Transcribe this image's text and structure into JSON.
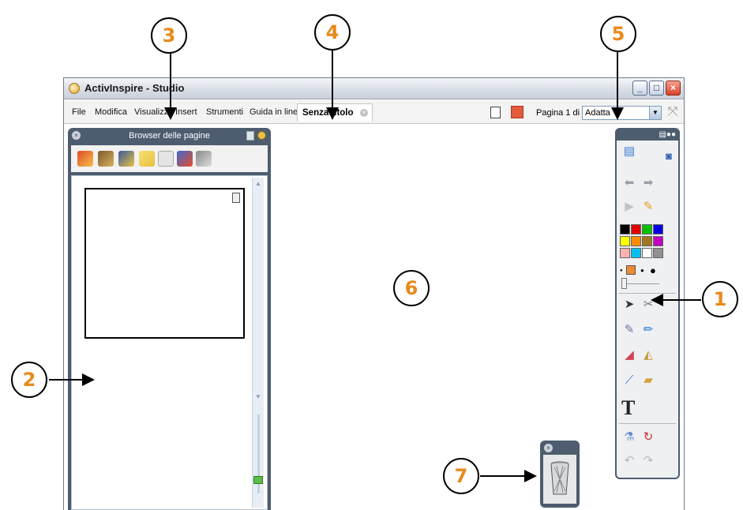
{
  "window": {
    "title": "ActivInspire - Studio"
  },
  "menu": {
    "items": [
      "File",
      "Modifica",
      "Visualizza",
      "Insert",
      "Strumenti",
      "Guida in linea"
    ]
  },
  "document_tab": {
    "label": "Senza titolo",
    "close_glyph": "×"
  },
  "page_nav": {
    "indicator": "Pagina 1 di 1",
    "zoom_value": "Adatta"
  },
  "page_browser": {
    "title": "Browser delle pagine",
    "tools": [
      "page-browser-icon",
      "resource-browser-icon",
      "object-browser-icon",
      "notes-browser-icon",
      "property-browser-icon",
      "action-browser-icon",
      "voting-browser-icon"
    ]
  },
  "toolbox": {
    "colors": [
      "#000000",
      "#e00000",
      "#00c000",
      "#0000e0",
      "#ffff00",
      "#ff8c00",
      "#a07820",
      "#c000c0",
      "#ffb0b0",
      "#00c0f0",
      "#ffffff",
      "#909090"
    ]
  },
  "callouts": [
    "1",
    "2",
    "3",
    "4",
    "5",
    "6",
    "7"
  ]
}
